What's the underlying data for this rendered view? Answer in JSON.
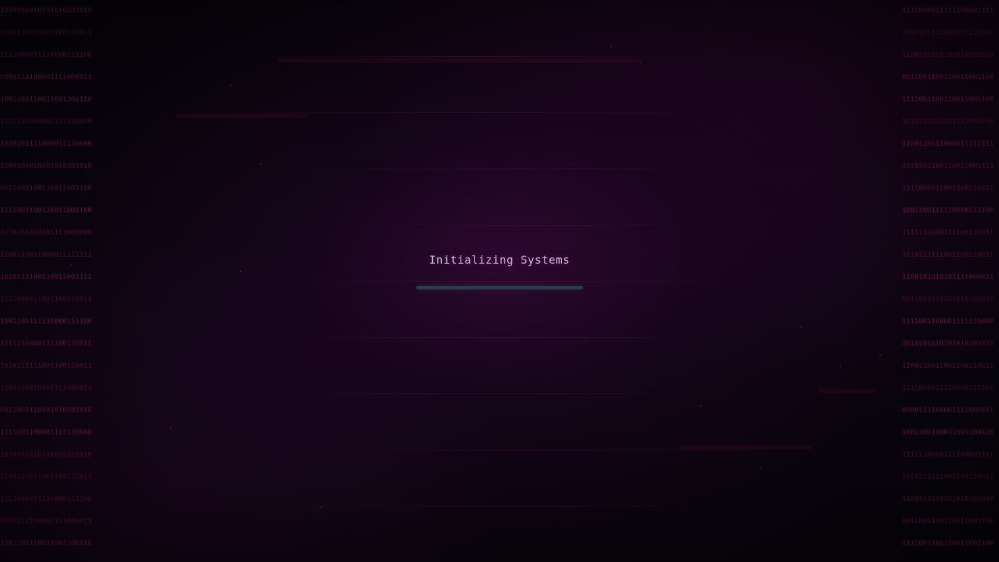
{
  "loader": {
    "title": "Initializing Systems",
    "progress": 0.0
  },
  "binary_left": [
    "1010101010101010101010",
    "1100110011001100110011",
    "1111000011110000111100",
    "0000111100001111000011",
    "1001100110011001100110",
    "1111110000001111110000",
    "1010101111000011110000",
    "1100101010101010101010",
    "0011001100110011001100",
    "1111001100110011001100",
    "1010101010101111000000",
    "1100110011000011111111",
    "1010111100110011001111",
    "1111000011001100110011",
    "1001100111110000111100",
    "1111110000111100110011",
    "1010111111001100110011",
    "1100101010101111000011",
    "0011001110101010101010",
    "1111001100001111110000",
    "1010101010101010101010",
    "1100110011001100110011",
    "1111000011110000111100",
    "0000111100001111000011",
    "1001100110011001100110"
  ],
  "binary_right": [
    "1111000011111100001111",
    "1010101111000011110000",
    "1100101010101010101010",
    "0011001100110011001100",
    "1111001100110011001100",
    "1010101010101111000000",
    "1100110011000011111111",
    "1010101100110011001111",
    "1111000011001100110011",
    "1001100111110000111100",
    "1111110000111100110011",
    "1010111111001100110011",
    "1100101010101111000011",
    "0011001110101010101010",
    "1111001100001111110000",
    "1010101010101010101010",
    "1100110011001100110011",
    "1111000011110000111100",
    "0000111100001111000011",
    "1001100110011001100110",
    "1111110000111100001111",
    "1010111111001100110011",
    "1100101010101010101010",
    "0011001100110011001100",
    "1111001100110011001100"
  ],
  "colors": {
    "background": "#07030a",
    "binary_text": "#5a0f3a",
    "title_text": "#c9b8d0",
    "progress_track": "#2b3e47",
    "progress_fill": "#4c8792",
    "particle": "#c0206a"
  }
}
